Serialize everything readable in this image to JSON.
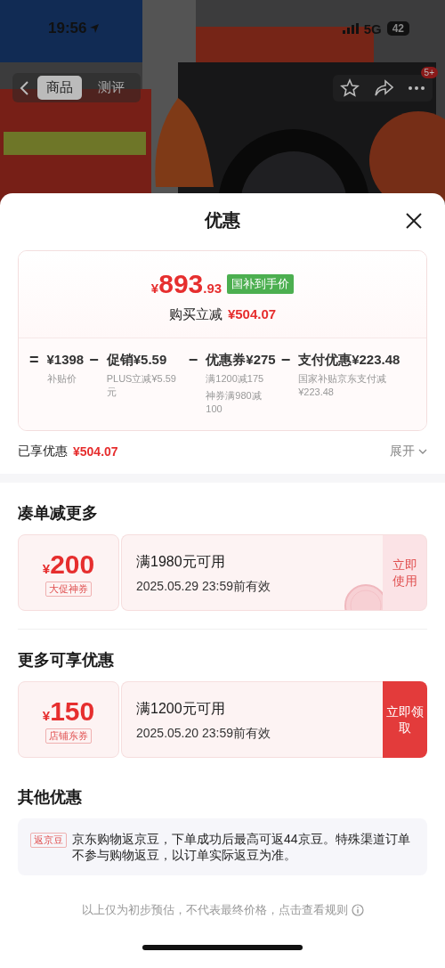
{
  "status_bar": {
    "time": "19:56",
    "network": "5G",
    "battery": "42"
  },
  "nav": {
    "tabs": [
      {
        "label": "商品",
        "selected": true
      },
      {
        "label": "测评",
        "selected": false
      }
    ],
    "badge": "5+"
  },
  "sheet": {
    "title": "优惠",
    "summary": {
      "price": {
        "symbol": "¥",
        "integer": "893",
        "decimals": ".93"
      },
      "price_tag": "国补到手价",
      "reduction_label": "购买立减",
      "reduction": "¥504.07",
      "breakdown": [
        {
          "op": "=",
          "amount": "¥1398",
          "notes": [
            "补贴价"
          ]
        },
        {
          "op": "−",
          "amount": "促销¥5.59",
          "notes": [
            "PLUS立减¥5.59元"
          ]
        },
        {
          "op": "−",
          "amount": "优惠券¥275",
          "notes": [
            "满1200减175",
            "神券满980减100"
          ]
        },
        {
          "op": "−",
          "amount": "支付优惠¥223.48",
          "notes": [
            "国家补贴京东支付减¥223.48"
          ]
        }
      ]
    },
    "enjoyed_label": "已享优惠",
    "enjoyed": "¥504.07",
    "expand": "展开",
    "sections": [
      {
        "title": "凑单减更多",
        "coupon": {
          "symbol": "¥",
          "amount": "200",
          "tag": "大促神券",
          "condition": "满1980元可用",
          "validity": "2025.05.29 23:59前有效",
          "action": "立即使用",
          "claimed": true
        }
      },
      {
        "title": "更多可享优惠",
        "coupon": {
          "symbol": "¥",
          "amount": "150",
          "tag": "店铺东券",
          "condition": "满1200元可用",
          "validity": "2025.05.20 23:59前有效",
          "action": "立即领取",
          "claimed": false
        }
      }
    ],
    "other": {
      "title": "其他优惠",
      "tag": "返京豆",
      "text": "京东购物返京豆，下单成功后最高可返44京豆。特殊渠道订单不参与购物返豆，以订单实际返豆为准。"
    },
    "footer": "以上仅为初步预估，不代表最终价格，点击查看规则"
  }
}
